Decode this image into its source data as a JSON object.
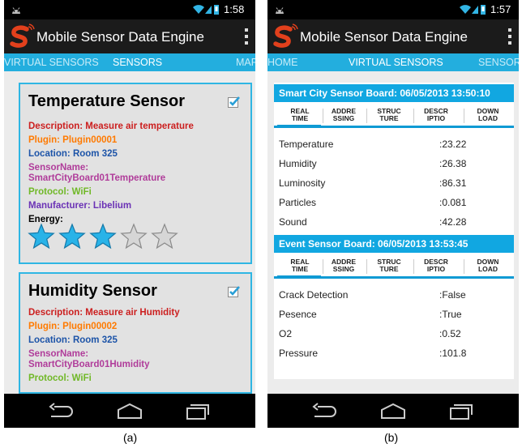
{
  "app_title": "Mobile Sensor Data Engine",
  "colors": {
    "tab_bar": "#23aede",
    "board_header": "#11a7e1",
    "card_border": "#2fb6e3"
  },
  "phone_a": {
    "time": "1:58",
    "tabs": [
      "VIRTUAL SENSORS",
      "SENSORS",
      "MAP"
    ],
    "cards": [
      {
        "title": "Temperature Sensor",
        "checked": true,
        "description": "Description:  Measure air temperature",
        "plugin": "Plugin: Plugin00001",
        "location": "Location: Room 325",
        "sensor_name_label": "SensorName:",
        "sensor_name": "SmartCityBoard01Temperature",
        "protocol": "Protocol: WiFi",
        "manufacturer": "Manufacturer: Libelium",
        "energy_label": "Energy:",
        "energy_rating": 3,
        "energy_max": 5
      },
      {
        "title": "Humidity Sensor",
        "checked": true,
        "description": "Description:  Measure air Humidity",
        "plugin": "Plugin: Plugin00002",
        "location": "Location: Room 325",
        "sensor_name_label": "SensorName:",
        "sensor_name": "SmartCityBoard01Humidity",
        "protocol": "Protocol: WiFi"
      }
    ],
    "caption": "(a)"
  },
  "phone_b": {
    "time": "1:57",
    "tabs": [
      "HOME",
      "VIRTUAL SENSORS",
      "SENSORS"
    ],
    "subtabs": [
      [
        "REAL",
        "TIME"
      ],
      [
        "ADDRE",
        "SSING"
      ],
      [
        "STRUC",
        "TURE"
      ],
      [
        "DESCR",
        "IPTIO"
      ],
      [
        "DOWN",
        "LOAD"
      ]
    ],
    "boards": [
      {
        "title": "Smart City Sensor Board: 06/05/2013 13:50:10",
        "rows": [
          {
            "k": "Temperature",
            "v": ":23.22"
          },
          {
            "k": "Humidity",
            "v": ":26.38"
          },
          {
            "k": "Luminosity",
            "v": ":86.31"
          },
          {
            "k": "Particles",
            "v": ":0.081"
          },
          {
            "k": "Sound",
            "v": ":42.28"
          }
        ]
      },
      {
        "title": "Event Sensor Board: 06/05/2013 13:53:45",
        "rows": [
          {
            "k": "Crack Detection",
            "v": ":False"
          },
          {
            "k": "Pesence",
            "v": ":True"
          },
          {
            "k": "O2",
            "v": ":0.52"
          },
          {
            "k": "Pressure",
            "v": ":101.8"
          }
        ]
      }
    ],
    "caption": "(b)"
  }
}
